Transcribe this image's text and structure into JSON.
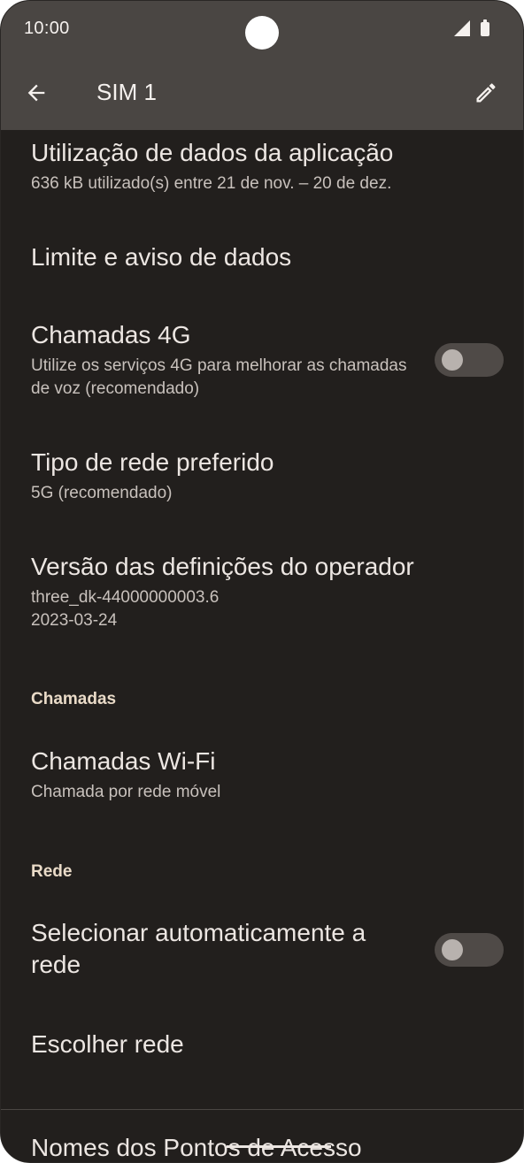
{
  "status_bar": {
    "time": "10:00",
    "icons": [
      "signal-icon",
      "battery-icon"
    ]
  },
  "app_bar": {
    "title": "SIM 1",
    "back_icon": "arrow-back-icon",
    "edit_icon": "pencil-icon"
  },
  "items": [
    {
      "title": "Utilização de dados da aplicação",
      "summary": "636 kB utilizado(s) entre 21 de nov. – 20 de dez."
    },
    {
      "title": "Limite e aviso de dados"
    },
    {
      "title": "Chamadas 4G",
      "summary": "Utilize os serviços 4G para melhorar as chamadas de voz (recomendado)",
      "toggle_on": false
    },
    {
      "title": "Tipo de rede preferido",
      "summary": "5G (recomendado)"
    },
    {
      "title": "Versão das definições do operador",
      "summary_line1": "three_dk-44000000003.6",
      "summary_line2": "2023-03-24"
    }
  ],
  "sections": {
    "calls": {
      "header": "Chamadas",
      "items": [
        {
          "title": "Chamadas Wi-Fi",
          "summary": "Chamada por rede móvel"
        }
      ]
    },
    "network": {
      "header": "Rede",
      "items": [
        {
          "title": "Selecionar automaticamente a rede",
          "toggle_on": false
        },
        {
          "title": "Escolher rede"
        },
        {
          "title": "Nomes dos Pontos de Acesso"
        }
      ]
    }
  },
  "colors": {
    "background": "#221f1d",
    "app_bar": "#4a4643",
    "text_primary": "#ece6e2",
    "text_secondary": "#c8c1bc",
    "section_header": "#eadbc8",
    "toggle_track_off": "#4f4a47"
  }
}
